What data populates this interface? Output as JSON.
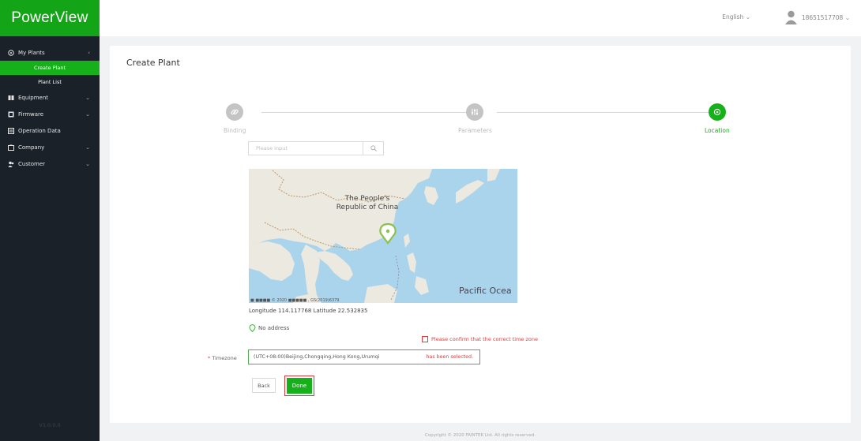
{
  "app": {
    "logo": "PowerView",
    "version": "V1.0.0.0"
  },
  "sidebar": {
    "items": [
      {
        "label": "My Plants",
        "icon": "plant-icon",
        "arrow": "‹"
      },
      {
        "label": "Equipment",
        "icon": "equipment-icon",
        "arrow": "⌄"
      },
      {
        "label": "Firmware",
        "icon": "firmware-icon",
        "arrow": "⌄"
      },
      {
        "label": "Operation Data",
        "icon": "data-icon",
        "arrow": ""
      },
      {
        "label": "Company",
        "icon": "company-icon",
        "arrow": "⌄"
      },
      {
        "label": "Customer",
        "icon": "customer-icon",
        "arrow": "⌄"
      }
    ],
    "sub_items": [
      {
        "label": "Create Plant",
        "active": true
      },
      {
        "label": "Plant List",
        "active": false
      }
    ]
  },
  "header": {
    "language": "English ⌄",
    "username": "18651517708 ⌄"
  },
  "main": {
    "title": "Create Plant",
    "steps": [
      {
        "label": "Binding",
        "icon": "link-icon",
        "state": "done"
      },
      {
        "label": "Parameters",
        "icon": "sliders-icon",
        "state": "done"
      },
      {
        "label": "Location",
        "icon": "location-pin-icon",
        "state": "active"
      }
    ],
    "search": {
      "placeholder": "Please input",
      "icon": "search-icon"
    },
    "map": {
      "label_country_line1": "The People's",
      "label_country_line2": "Republic of China",
      "label_ocean": "Pacific Ocea",
      "attribution": "■ ■■■■ © 2020 ■■■■■ , GS(2019)6379"
    },
    "coordinates": "Longitude 114.117768 Latitude 22.532835",
    "address": "No address",
    "confirm_text": "Please confirm that the correct time zone",
    "timezone": {
      "label": "Timezone",
      "required_mark": "*",
      "value": "(UTC+08:00)Beijing,Chongqing,Hong Kong,Urumqi",
      "note": "has been selected."
    },
    "buttons": {
      "back": "Back",
      "done": "Done"
    }
  },
  "footer": "Copyright © 2020 FAINTEK Ltd. All rights reserved.",
  "colors": {
    "brand": "#16b01a",
    "sidebar_bg": "#1a2129",
    "error": "#e03b3b"
  }
}
